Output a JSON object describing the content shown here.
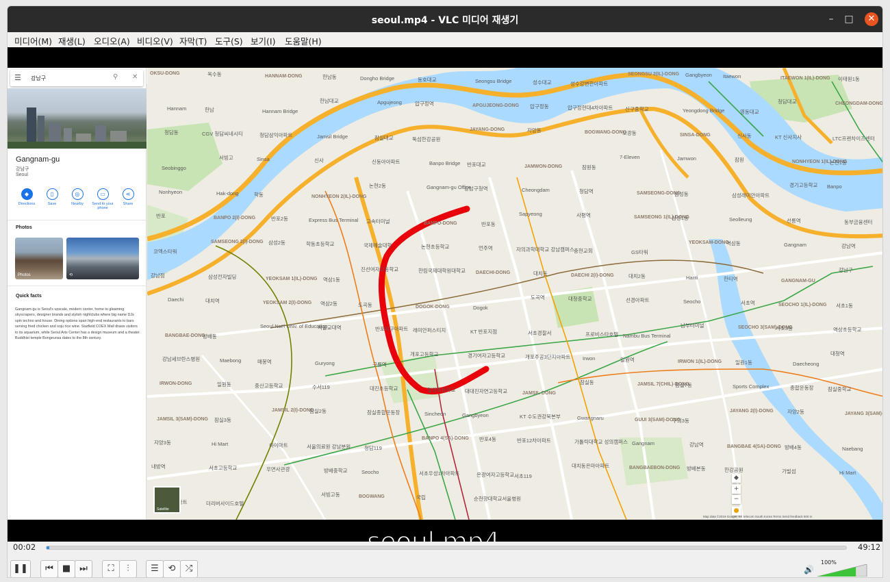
{
  "window": {
    "title": "seoul.mp4 - VLC 미디어 재생기",
    "minimize_symbol": "–",
    "maximize_symbol": "□",
    "close_symbol": "✕"
  },
  "menu": [
    "미디어(M)",
    "재생(L)",
    "오디오(A)",
    "비디오(V)",
    "자막(T)",
    "도구(S)",
    "보기(I)",
    "도움말(H)"
  ],
  "overlay_title": "seoul.mp4",
  "maps_panel": {
    "search_query": "강남구",
    "place_name": "Gangnam-gu",
    "place_korean": "강남구",
    "place_city": "Seoul",
    "actions": [
      "Directions",
      "Save",
      "Nearby",
      "Send to your phone",
      "Share"
    ],
    "action_icons": [
      "directions-icon",
      "bookmark-icon",
      "nearby-icon",
      "phone-icon",
      "share-icon"
    ],
    "photos_heading": "Photos",
    "photo_caption": "Photos",
    "quick_facts_heading": "Quick facts",
    "quick_facts": "Gangnam-gu is Seoul's upscale, modern center, home to gleaming skyscrapers, designer brands and stylish nightclubs where big name DJs spin techno and house. Dining options span high-end restaurants to bars serving fried chicken and soju rice wine. Starfield COEX Mall draws visitors to its aquarium, while Seoul Arts Center has a design museum and a theater. Buddhist temple Bongeunsa dates to the 8th century."
  },
  "map": {
    "satellite_label": "Satellite",
    "attribution": "Map data ©2019 Google, SK telecom   South Korea   Terms   Send feedback   500 m",
    "river_color": "#aadaff",
    "highway_color": "#f6b02b",
    "route_color": "#e8000b",
    "labels": [
      {
        "t": "OKSU-DONG"
      },
      {
        "t": "옥수동"
      },
      {
        "t": "HANNAM-DONG"
      },
      {
        "t": "한남동"
      },
      {
        "t": "Dongho Bridge"
      },
      {
        "t": "동호대교"
      },
      {
        "t": "Seongsu Bridge"
      },
      {
        "t": "성수대교"
      },
      {
        "t": "성수강변한아파트"
      },
      {
        "t": "SEONGSU 2(IL)-DONG"
      },
      {
        "t": "Gangbyeon"
      },
      {
        "t": "Itaewon"
      },
      {
        "t": "ITAEWON 1(IL)-DONG"
      },
      {
        "t": "이태원1동"
      },
      {
        "t": "Hannam"
      },
      {
        "t": "한남"
      },
      {
        "t": "Hannam Bridge"
      },
      {
        "t": "한남대교"
      },
      {
        "t": "Apgujeong"
      },
      {
        "t": "압구정역"
      },
      {
        "t": "APGUJEONG-DONG"
      },
      {
        "t": "압구정동"
      },
      {
        "t": "압구정현대4차아파트"
      },
      {
        "t": "신구중학교"
      },
      {
        "t": "Yeongdong Bridge"
      },
      {
        "t": "영동대교"
      },
      {
        "t": "청담대교"
      },
      {
        "t": "CHEONGDAM-DONG"
      },
      {
        "t": "청담동"
      },
      {
        "t": "CGV 청담씨네시티"
      },
      {
        "t": "청담삼익아파트"
      },
      {
        "t": "Jamsil Bridge"
      },
      {
        "t": "잠실대교"
      },
      {
        "t": "뚝섬한강공원"
      },
      {
        "t": "JAYANG-DONG"
      },
      {
        "t": "자양동"
      },
      {
        "t": "BOGWANG-DONG"
      },
      {
        "t": "보광동"
      },
      {
        "t": "SINSA-DONG"
      },
      {
        "t": "신사동"
      },
      {
        "t": "KT 신사지사"
      },
      {
        "t": "LTC프랜차이즈센터"
      },
      {
        "t": "Seobinggo"
      },
      {
        "t": "서빙고"
      },
      {
        "t": "Sinsa"
      },
      {
        "t": "신사"
      },
      {
        "t": "신동아아파트"
      },
      {
        "t": "Banpo Bridge"
      },
      {
        "t": "반포대교"
      },
      {
        "t": "JAMWON-DONG"
      },
      {
        "t": "잠원동"
      },
      {
        "t": "7-Eleven"
      },
      {
        "t": "Jamwon"
      },
      {
        "t": "잠원"
      },
      {
        "t": "NONHYEON 1(IL)-DONG"
      },
      {
        "t": "논현1동"
      },
      {
        "t": "Nonhyeon"
      },
      {
        "t": "Hak-dong"
      },
      {
        "t": "학동"
      },
      {
        "t": "NONHYEON 2(IL)-DONG"
      },
      {
        "t": "논현2동"
      },
      {
        "t": "Gangnam-gu Office"
      },
      {
        "t": "강남구청역"
      },
      {
        "t": "Cheongdam"
      },
      {
        "t": "청담역"
      },
      {
        "t": "SAMSEONG-DONG"
      },
      {
        "t": "삼성동"
      },
      {
        "t": "삼성래미안아파트"
      },
      {
        "t": "경기고등학교"
      },
      {
        "t": "Banpo"
      },
      {
        "t": "반포"
      },
      {
        "t": "BANPO 2(I)-DONG"
      },
      {
        "t": "반포2동"
      },
      {
        "t": "Express Bus Terminal"
      },
      {
        "t": "고속터미널"
      },
      {
        "t": "BANPO-DONG"
      },
      {
        "t": "반포동"
      },
      {
        "t": "Sapyeong"
      },
      {
        "t": "사평역"
      },
      {
        "t": "SAMSEONG 1(IL)-DONG"
      },
      {
        "t": "삼성1동"
      },
      {
        "t": "Seolleung"
      },
      {
        "t": "선릉역"
      },
      {
        "t": "동부금융센터"
      },
      {
        "t": "코엑스타워"
      },
      {
        "t": "SAMSEONG 2(I)-DONG"
      },
      {
        "t": "삼성2동"
      },
      {
        "t": "학동초등학교"
      },
      {
        "t": "국제예술대학"
      },
      {
        "t": "논현초등학교"
      },
      {
        "t": "언주역"
      },
      {
        "t": "자의과학대학교 강남캠퍼스"
      },
      {
        "t": "충현교회"
      },
      {
        "t": "GS타워"
      },
      {
        "t": "YEOKSAM-DONG"
      },
      {
        "t": "역삼동"
      },
      {
        "t": "Gangnam"
      },
      {
        "t": "강남역"
      },
      {
        "t": "강남점"
      },
      {
        "t": "삼성전자빌딩"
      },
      {
        "t": "YEOKSAM 1(IL)-DONG"
      },
      {
        "t": "역삼1동"
      },
      {
        "t": "진선여자고등학교"
      },
      {
        "t": "한림국제대학원대학교"
      },
      {
        "t": "DAECHI-DONG"
      },
      {
        "t": "대치동"
      },
      {
        "t": "DAECHI 2(I)-DONG"
      },
      {
        "t": "대치2동"
      },
      {
        "t": "Hanti"
      },
      {
        "t": "한티역"
      },
      {
        "t": "GANGNAM-GU"
      },
      {
        "t": "강남구"
      },
      {
        "t": "Daechi"
      },
      {
        "t": "대치역"
      },
      {
        "t": "YEOKSAM 2(I)-DONG"
      },
      {
        "t": "역삼2동"
      },
      {
        "t": "도곡동"
      },
      {
        "t": "DOGOK-DONG"
      },
      {
        "t": "Dogok"
      },
      {
        "t": "도곡역"
      },
      {
        "t": "대청중학교"
      },
      {
        "t": "선경아파트"
      },
      {
        "t": "Seocho"
      },
      {
        "t": "서초역"
      },
      {
        "t": "SEOCHO 1(IL)-DONG"
      },
      {
        "t": "서초1동"
      },
      {
        "t": "BANGBAE-DONG"
      },
      {
        "t": "방배동"
      },
      {
        "t": "Seoul Nat'l Univ. of Education"
      },
      {
        "t": "서울교대역"
      },
      {
        "t": "반포지구아파트"
      },
      {
        "t": "래미안퍼스티지"
      },
      {
        "t": "KT 반포지점"
      },
      {
        "t": "서초경찰서"
      },
      {
        "t": "프로비스타호텔"
      },
      {
        "t": "Nambu Bus Terminal"
      },
      {
        "t": "남부터미널"
      },
      {
        "t": "SEOCHO 3(SAM)-DONG"
      },
      {
        "t": "서초3동"
      },
      {
        "t": "역삼초등학교"
      },
      {
        "t": "강남세브란스병원"
      },
      {
        "t": "Maebong"
      },
      {
        "t": "매봉역"
      },
      {
        "t": "Guryong"
      },
      {
        "t": "구룡역"
      },
      {
        "t": "개포고등학교"
      },
      {
        "t": "경기여자고등학교"
      },
      {
        "t": "개포주공3단지아파트"
      },
      {
        "t": "Irwon"
      },
      {
        "t": "일원역"
      },
      {
        "t": "IRWON 1(IL)-DONG"
      },
      {
        "t": "일원1동"
      },
      {
        "t": "Daecheong"
      },
      {
        "t": "대청역"
      },
      {
        "t": "IRWON-DONG"
      },
      {
        "t": "일원동"
      },
      {
        "t": "중산고등학교"
      },
      {
        "t": "수서119"
      },
      {
        "t": "대진초등학교"
      },
      {
        "t": "일원초등학교"
      },
      {
        "t": "대대진자연고등학교"
      },
      {
        "t": "JAMSIL-DONG"
      },
      {
        "t": "잠실동"
      },
      {
        "t": "JAMSIL 7(CHIL)-DONG"
      },
      {
        "t": "잠실7동"
      },
      {
        "t": "Sports Complex"
      },
      {
        "t": "종합운동장"
      },
      {
        "t": "잠실중학교"
      },
      {
        "t": "JAMSIL 3(SAM)-DONG"
      },
      {
        "t": "잠실3동"
      },
      {
        "t": "JAMSIL 2(I)-DONG"
      },
      {
        "t": "잠실2동"
      },
      {
        "t": "잠실종합운동장"
      },
      {
        "t": "Sincheon"
      },
      {
        "t": "Gangbyeon"
      },
      {
        "t": "KT 수도권강북본부"
      },
      {
        "t": "Gwangnaru"
      },
      {
        "t": "GUUI 3(SAM)-DONG"
      },
      {
        "t": "구의3동"
      },
      {
        "t": "JAYANG 2(I)-DONG"
      },
      {
        "t": "자양2동"
      },
      {
        "t": "JAYANG 3(SAM)-DONG"
      },
      {
        "t": "자양3동"
      },
      {
        "t": "Hi Mart"
      },
      {
        "t": "하이마트"
      },
      {
        "t": "서울의료원 강남분원"
      },
      {
        "t": "청담119"
      },
      {
        "t": "BANPO 4(SA)-DONG"
      },
      {
        "t": "반포4동"
      },
      {
        "t": "반포12차아파트"
      },
      {
        "t": "가톨릭대학교 성의캠퍼스"
      },
      {
        "t": "Gangnam"
      },
      {
        "t": "강남역"
      },
      {
        "t": "BANGBAE 4(SA)-DONG"
      },
      {
        "t": "방배4동"
      },
      {
        "t": "Naebang"
      },
      {
        "t": "내방역"
      },
      {
        "t": "서초고등학교"
      },
      {
        "t": "우면사관광"
      },
      {
        "t": "방배중학교"
      },
      {
        "t": "Seocho"
      },
      {
        "t": "서초우성1차아파트"
      },
      {
        "t": "은광여자고등학교"
      },
      {
        "t": "서초119"
      },
      {
        "t": "대치동은마아파트"
      },
      {
        "t": "BANGBAEBON-DONG"
      },
      {
        "t": "방배본동"
      },
      {
        "t": "한강공원"
      },
      {
        "t": "가빌섬"
      },
      {
        "t": "Hi Mart"
      },
      {
        "t": "하이마트"
      },
      {
        "t": "더리버사이드호텔"
      },
      {
        "t": "인디플러스"
      },
      {
        "t": "서빙고동"
      },
      {
        "t": "BOGWANG"
      },
      {
        "t": "국립"
      },
      {
        "t": "순천향대학교서울병원"
      }
    ]
  },
  "player": {
    "elapsed": "00:02",
    "duration": "49:12",
    "progress_fraction": 0.0007,
    "volume": "100%",
    "volume_level_fraction": 1.0,
    "buttons": {
      "pause": "❚❚",
      "prev": "⏮",
      "stop": "■",
      "next": "⏭",
      "fullscreen": "⛶",
      "extended": "⫶",
      "playlist": "☰",
      "loop": "⟲",
      "random": "⤮"
    },
    "mute_symbol": "🔊"
  },
  "map_controls": {
    "zoom_in": "+",
    "zoom_out": "−",
    "pegman": "●",
    "compass": "◆"
  }
}
